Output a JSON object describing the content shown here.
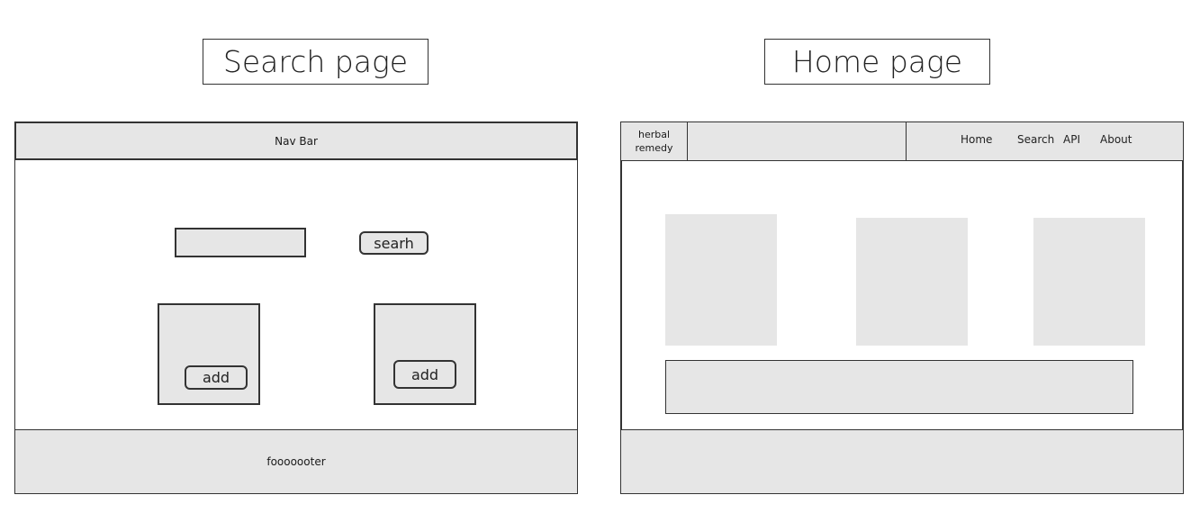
{
  "search_page": {
    "title": "Search page",
    "navbar_label": "Nav Bar",
    "search_button_label": "searh",
    "cards": [
      {
        "add_label": "add"
      },
      {
        "add_label": "add"
      }
    ],
    "footer_label": "fooooooter"
  },
  "home_page": {
    "title": "Home page",
    "logo_label": "herbal remedy",
    "nav_links": [
      "Home",
      "Search",
      "API",
      "About"
    ]
  },
  "colors": {
    "fill": "#e6e6e6",
    "stroke": "#333333",
    "background": "#ffffff"
  }
}
